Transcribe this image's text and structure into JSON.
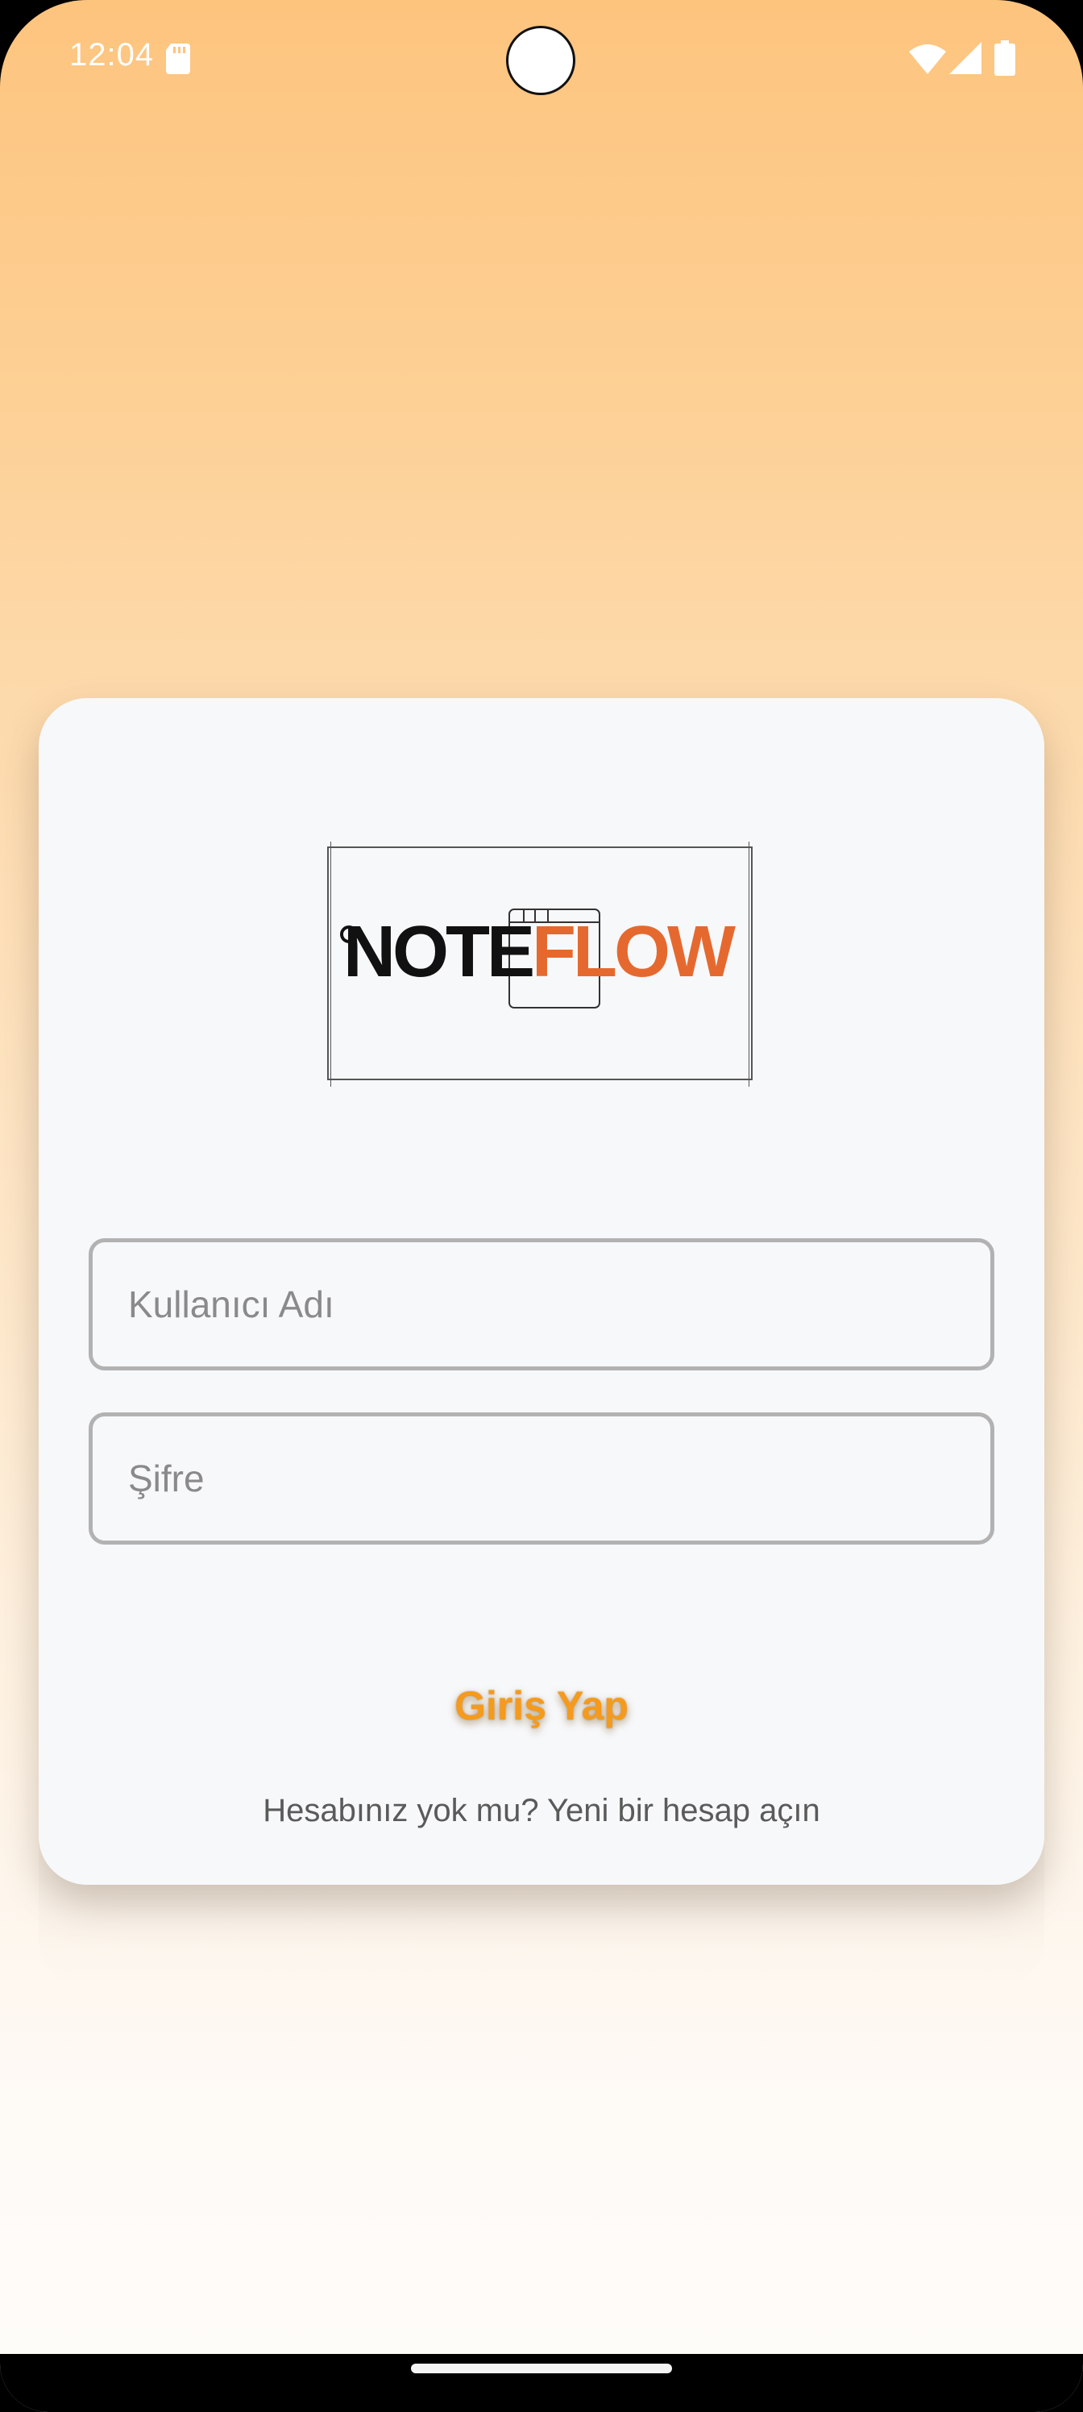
{
  "status_bar": {
    "time": "12:04",
    "icons": [
      "sd-card-icon",
      "wifi-icon",
      "signal-icon",
      "battery-icon"
    ]
  },
  "logo": {
    "part1": "NOTE",
    "part2": "FLOW",
    "colors": {
      "note": "#111111",
      "flow": "#e5692f"
    }
  },
  "form": {
    "username_placeholder": "Kullanıcı Adı",
    "password_placeholder": "Şifre",
    "login_label": "Giriş Yap",
    "signup_text": "Hesabınız yok mu? Yeni bir hesap açın"
  },
  "colors": {
    "accent": "#f59a1c",
    "card_background": "#f7f8fa",
    "gradient_top": "#fdc47e",
    "gradient_bottom": "#fefcfa"
  }
}
